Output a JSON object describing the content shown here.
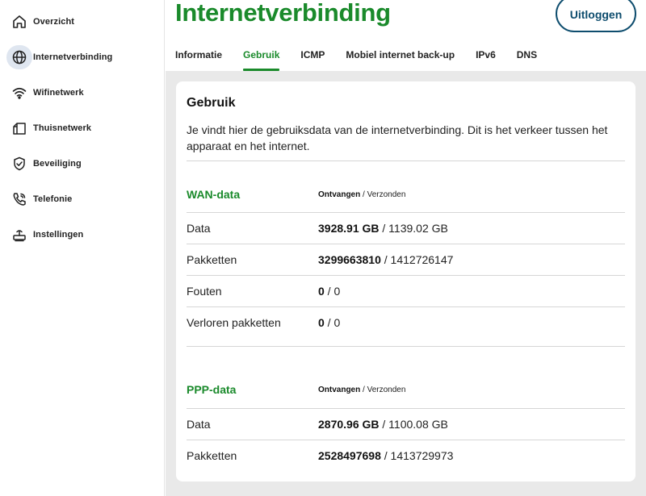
{
  "sidebar": {
    "items": [
      {
        "label": "Overzicht",
        "icon": "home-icon"
      },
      {
        "label": "Internetverbinding",
        "icon": "globe-icon"
      },
      {
        "label": "Wifinetwerk",
        "icon": "wifi-icon"
      },
      {
        "label": "Thuisnetwerk",
        "icon": "house-network-icon"
      },
      {
        "label": "Beveiliging",
        "icon": "shield-icon"
      },
      {
        "label": "Telefonie",
        "icon": "phone-icon"
      },
      {
        "label": "Instellingen",
        "icon": "router-icon"
      }
    ],
    "active_index": 1
  },
  "header": {
    "title": "Internetverbinding",
    "logout_label": "Uitloggen",
    "tabs": [
      "Informatie",
      "Gebruik",
      "ICMP",
      "Mobiel internet back-up",
      "IPv6",
      "DNS"
    ],
    "active_tab": "Gebruik"
  },
  "card": {
    "title": "Gebruik",
    "description": "Je vindt hier de gebruiksdata van de internetverbinding. Dit is het verkeer tussen het apparaat en het internet.",
    "sections": [
      {
        "title": "WAN-data",
        "legend_received": "Ontvangen",
        "legend_sep": " / ",
        "legend_sent": "Verzonden",
        "rows": [
          {
            "label": "Data",
            "received": "3928.91 GB",
            "sent": "1139.02 GB"
          },
          {
            "label": "Pakketten",
            "received": "3299663810",
            "sent": "1412726147"
          },
          {
            "label": "Fouten",
            "received": "0",
            "sent": "0"
          },
          {
            "label": "Verloren pakketten",
            "received": "0",
            "sent": "0"
          }
        ]
      },
      {
        "title": "PPP-data",
        "legend_received": "Ontvangen",
        "legend_sep": " / ",
        "legend_sent": "Verzonden",
        "rows": [
          {
            "label": "Data",
            "received": "2870.96 GB",
            "sent": "1100.08 GB"
          },
          {
            "label": "Pakketten",
            "received": "2528497698",
            "sent": "1413729973"
          }
        ]
      }
    ]
  },
  "colors": {
    "accent_green": "#1a8a2b",
    "logout_border": "#0e4d6e",
    "background": "#e9e9e9",
    "active_nav_bg": "#dfe6f0"
  }
}
